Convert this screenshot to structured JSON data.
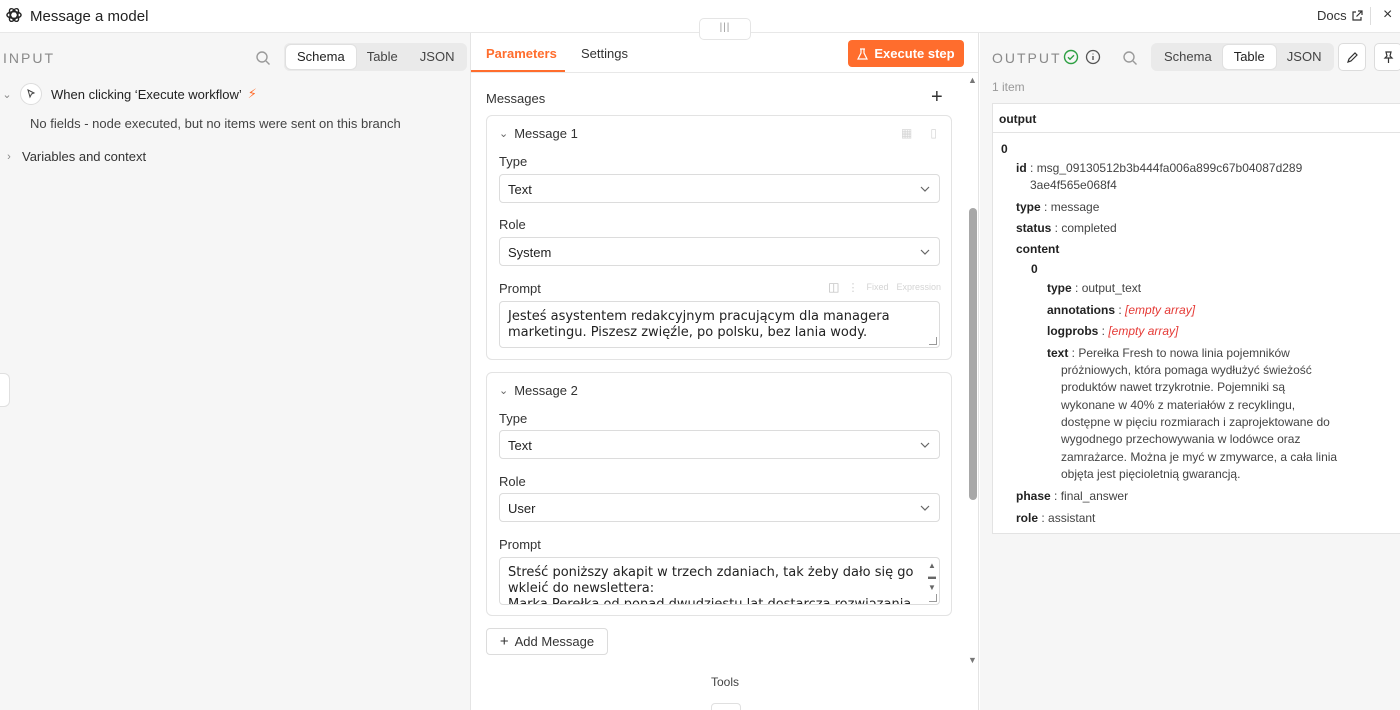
{
  "window": {
    "title": "Message a model",
    "docs_label": "Docs",
    "close_glyph": "×",
    "handle_glyph": "|||"
  },
  "input": {
    "title": "INPUT",
    "views": [
      "Schema",
      "Table",
      "JSON"
    ],
    "active_view": "Schema",
    "trigger_label": "When clicking ‘Execute workflow’",
    "no_fields_text": "No fields - node executed, but no items were sent on this branch",
    "variables_label": "Variables and context"
  },
  "params": {
    "tabs": [
      "Parameters",
      "Settings"
    ],
    "active_tab": "Parameters",
    "execute_label": "Execute step",
    "messages_label": "Messages",
    "messages": [
      {
        "title": "Message 1",
        "type_label": "Type",
        "type_value": "Text",
        "role_label": "Role",
        "role_value": "System",
        "prompt_label": "Prompt",
        "prompt_value": "Jesteś asystentem redakcyjnym pracującym dla managera marketingu. Piszesz zwięźle, po polsku, bez lania wody.",
        "fixed_label": "Fixed",
        "expression_label": "Expression"
      },
      {
        "title": "Message 2",
        "type_label": "Type",
        "type_value": "Text",
        "role_label": "Role",
        "role_value": "User",
        "prompt_label": "Prompt",
        "prompt_value": "Streść poniższy akapit w trzech zdaniach, tak żeby dało się go wkleić do newslettera:\nMarka Perełka od ponad dwudziestu lat dostarcza rozwiązania z"
      }
    ],
    "add_message_label": "Add Message",
    "tools_label": "Tools"
  },
  "output": {
    "title": "OUTPUT",
    "views": [
      "Schema",
      "Table",
      "JSON"
    ],
    "active_view": "Table",
    "item_count": "1 item",
    "column_header": "output",
    "index_0": "0",
    "id_key": "id",
    "id_value_line1": "msg_09130512b3b444fa006a899c67b04087d289",
    "id_value_line2": "3ae4f565e068f4",
    "type_key": "type",
    "type_value": "message",
    "status_key": "status",
    "status_value": "completed",
    "content_key": "content",
    "content_index": "0",
    "c_type_key": "type",
    "c_type_value": "output_text",
    "annotations_key": "annotations",
    "annotations_value": "[empty array]",
    "logprobs_key": "logprobs",
    "logprobs_value": "[empty array]",
    "text_key": "text",
    "text_value_lines": [
      "Perełka Fresh to nowa linia pojemników",
      "próżniowych, która pomaga wydłużyć świeżość",
      "produktów nawet trzykrotnie. Pojemniki są",
      "wykonane w 40% z materiałów z recyklingu,",
      "dostępne w pięciu rozmiarach i zaprojektowane do",
      "wygodnego przechowywania w lodówce oraz",
      "zamrażarce. Można je myć w zmywarce, a cała linia",
      "objęta jest pięcioletnią gwarancją."
    ],
    "phase_key": "phase",
    "phase_value": "final_answer",
    "role_key": "role",
    "role_value": "assistant"
  },
  "colors": {
    "accent": "#ff6d2d",
    "success": "#2ea043",
    "empty_array": "#e53935"
  }
}
